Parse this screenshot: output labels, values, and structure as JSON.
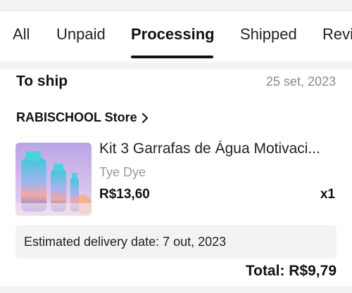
{
  "tabs": [
    {
      "label": "All"
    },
    {
      "label": "Unpaid"
    },
    {
      "label": "Processing",
      "active": true
    },
    {
      "label": "Shipped"
    },
    {
      "label": "Revi"
    }
  ],
  "order": {
    "status": "To ship",
    "date": "25 set, 2023",
    "store_name": "RABISCHOOL Store",
    "item": {
      "title": "Kit 3 Garrafas de Água Motivaci...",
      "variant": "Tye Dye",
      "price": "R$13,60",
      "quantity": "x1"
    },
    "delivery_text": "Estimated delivery date: 7 out, 2023",
    "total": "Total: R$9,79"
  },
  "icons": {
    "store_chevron": "chevron-right-icon"
  },
  "colors": {
    "active_tab": "#111111",
    "muted_text": "#8a8a8a",
    "delivery_bg": "#f3f3f3"
  }
}
